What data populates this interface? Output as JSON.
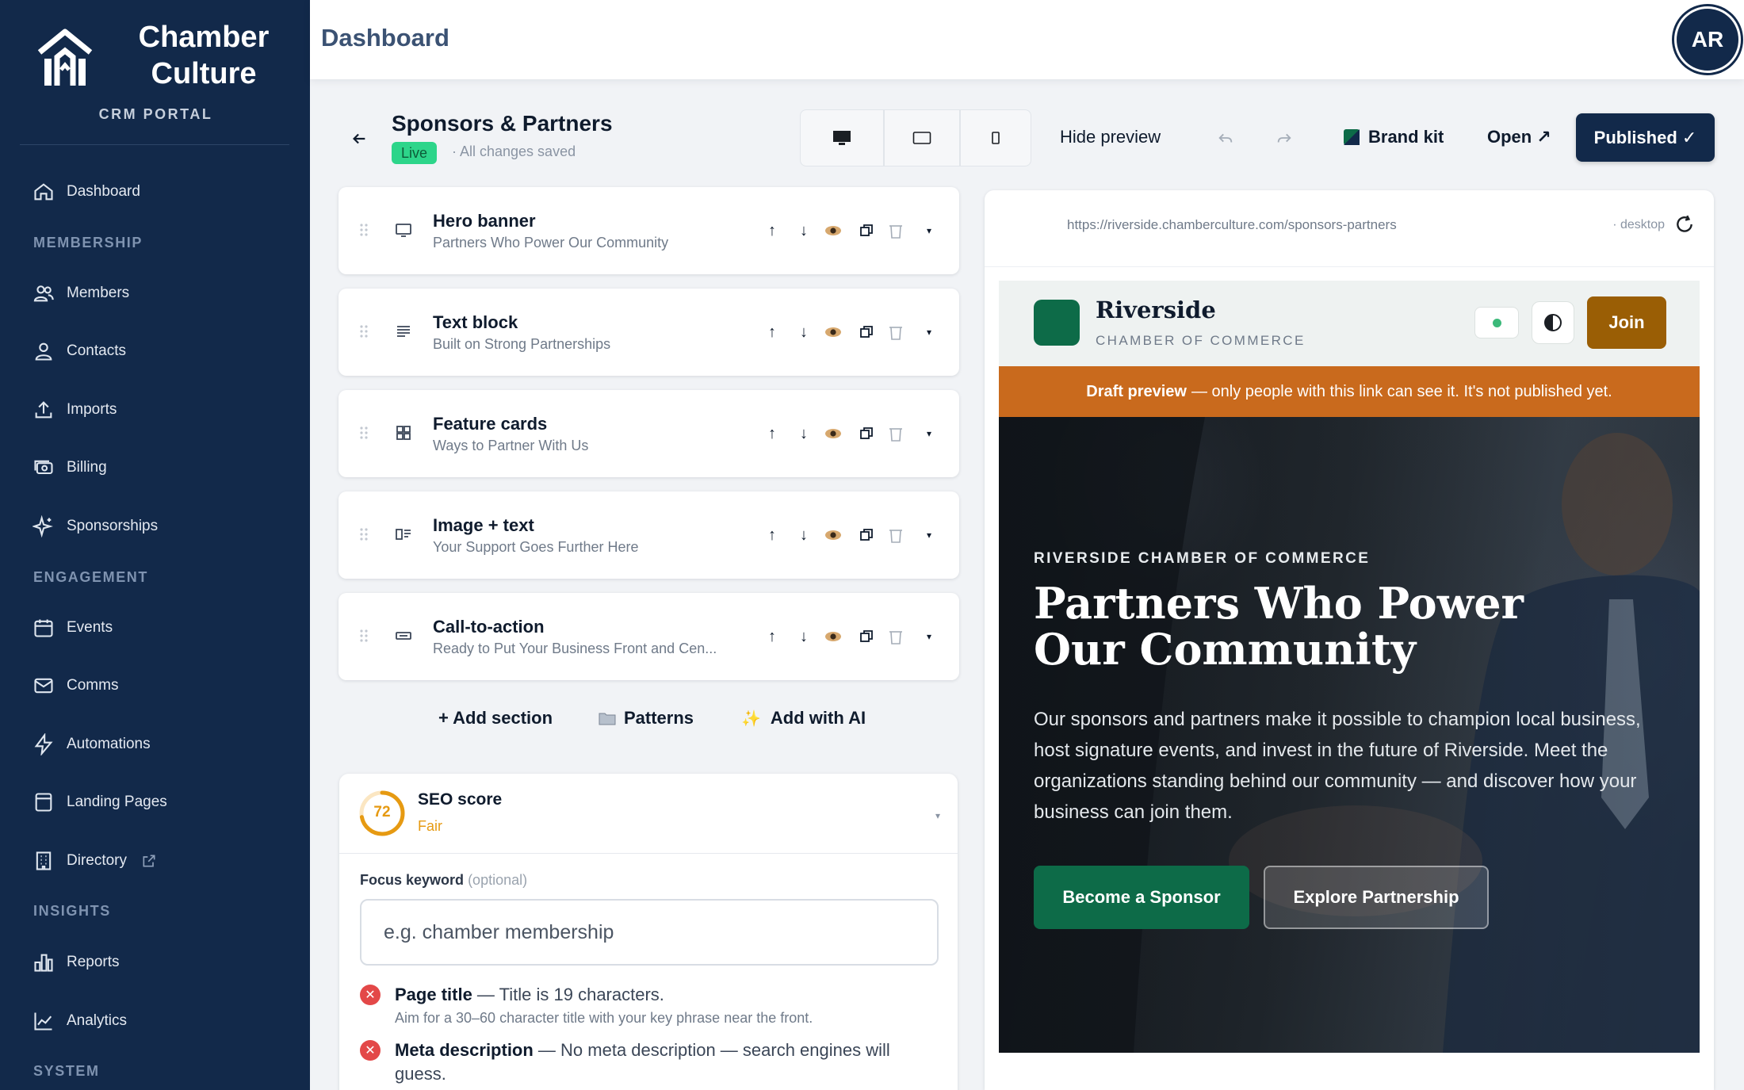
{
  "brand": {
    "name": "Chamber Culture",
    "subtitle": "CRM PORTAL"
  },
  "sidebar": {
    "sections": {
      "membership": "MEMBERSHIP",
      "engagement": "ENGAGEMENT",
      "insights": "INSIGHTS",
      "system": "SYSTEM"
    },
    "items": {
      "dashboard": "Dashboard",
      "members": "Members",
      "contacts": "Contacts",
      "imports": "Imports",
      "billing": "Billing",
      "sponsorships": "Sponsorships",
      "events": "Events",
      "comms": "Comms",
      "automations": "Automations",
      "landing_pages": "Landing Pages",
      "directory": "Directory",
      "reports": "Reports",
      "analytics": "Analytics"
    }
  },
  "topbar": {
    "title": "Dashboard",
    "avatar_initials": "AR"
  },
  "editor": {
    "page_name": "Sponsors & Partners",
    "status_badge": "Live",
    "save_status": "· All changes saved",
    "hide_preview": "Hide preview",
    "brand_kit": "Brand kit",
    "open": "Open ↗",
    "publish": "Published ✓"
  },
  "sections": [
    {
      "title": "Hero banner",
      "subtitle": "Partners Who Power Our Community",
      "icon": "monitor-icon"
    },
    {
      "title": "Text block",
      "subtitle": "Built on Strong Partnerships",
      "icon": "text-lines-icon"
    },
    {
      "title": "Feature cards",
      "subtitle": "Ways to Partner With Us",
      "icon": "grid-icon"
    },
    {
      "title": "Image + text",
      "subtitle": "Your Support Goes Further Here",
      "icon": "image-text-icon"
    },
    {
      "title": "Call-to-action",
      "subtitle": "Ready to Put Your Business Front and Cen...",
      "icon": "button-icon"
    }
  ],
  "add_actions": {
    "add_section": "+ Add section",
    "patterns": "Patterns",
    "add_ai": "Add with AI"
  },
  "seo": {
    "score": "72",
    "score_value": 72,
    "title": "SEO score",
    "grade": "Fair",
    "focus_label": "Focus keyword",
    "focus_optional": "(optional)",
    "focus_placeholder": "e.g. chamber membership",
    "checks": [
      {
        "label": "Page title",
        "detail": " — Title is 19 characters.",
        "hint": "Aim for a 30–60 character title with your key phrase near the front."
      },
      {
        "label": "Meta description",
        "detail": " — No meta description — search engines will guess.",
        "hint": ""
      }
    ]
  },
  "preview": {
    "url": "https://riverside.chamberculture.com/sponsors-partners",
    "device": "· desktop",
    "site_name": "Riverside",
    "site_tagline": "CHAMBER OF COMMERCE",
    "join": "Join",
    "draft_bold": "Draft preview",
    "draft_text": "— only people with this link can see it. It's not published yet.",
    "eyebrow": "RIVERSIDE CHAMBER OF COMMERCE",
    "headline": "Partners Who Power Our Community",
    "body": "Our sponsors and partners make it possible to champion local business, host signature events, and invest in the future of Riverside. Meet the organizations standing behind our community — and discover how your business can join them.",
    "cta_primary": "Become a Sponsor",
    "cta_secondary": "Explore Partnership"
  },
  "colors": {
    "sidebar": "#12294a",
    "accent_green": "#0d6b48",
    "draft_orange": "#c96a1d",
    "join_brown": "#9a5e05",
    "seo_fair": "#e69a12",
    "live_green": "#2dd58a"
  }
}
